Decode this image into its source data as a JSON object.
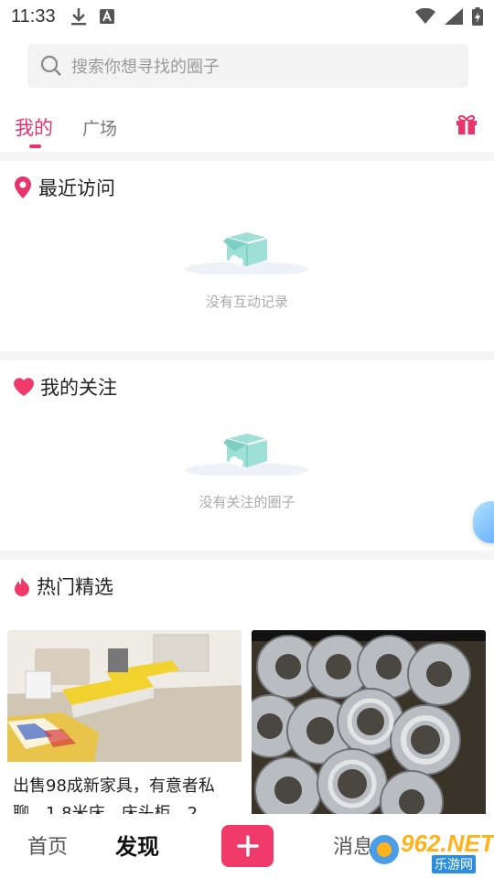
{
  "status_bar": {
    "time": "11:33"
  },
  "search": {
    "placeholder": "搜索你想寻找的圈子"
  },
  "tabs": {
    "mine": "我的",
    "square": "广场"
  },
  "recent": {
    "title": "最近访问",
    "empty_text": "没有互动记录"
  },
  "follow": {
    "title": "我的关注",
    "empty_text": "没有关注的圈子"
  },
  "hot": {
    "title": "热门精选",
    "cards": [
      {
        "title": "出售98成新家具，有意者私聊，1.8米床、床头柜、2"
      }
    ]
  },
  "bottom_nav": {
    "home": "首页",
    "discover": "发现",
    "messages": "消息"
  },
  "watermark": {
    "brand": "962.NET",
    "sub": "乐游网"
  },
  "colors": {
    "accent": "#e8336b",
    "plus_button": "#f03a6a"
  }
}
